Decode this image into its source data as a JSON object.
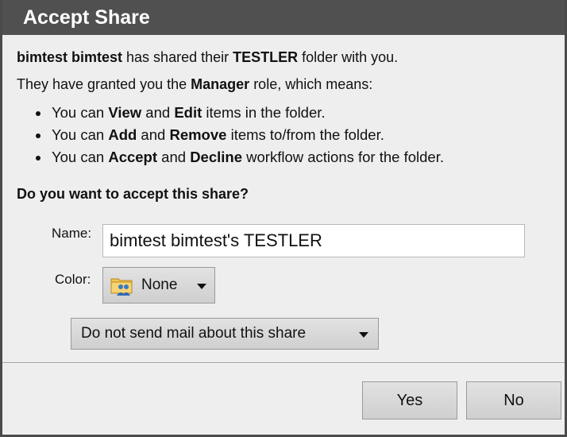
{
  "dialog": {
    "title": "Accept Share",
    "share_user": "bimtest bimtest",
    "share_text_1": " has shared their ",
    "folder": "TESTLER",
    "share_text_2": " folder with you.",
    "role_text_1": "They have granted you the ",
    "role": "Manager",
    "role_text_2": " role, which means:",
    "bullets": [
      {
        "p1": "You can ",
        "b1": "View",
        "p2": " and ",
        "b2": "Edit",
        "p3": " items in the folder."
      },
      {
        "p1": "You can ",
        "b1": "Add",
        "p2": " and ",
        "b2": "Remove",
        "p3": " items to/from the folder."
      },
      {
        "p1": "You can ",
        "b1": "Accept",
        "p2": " and ",
        "b2": "Decline",
        "p3": " workflow actions for the folder."
      }
    ],
    "question": "Do you want to accept this share?",
    "name_label": "Name:",
    "name_value": "bimtest bimtest's TESTLER",
    "color_label": "Color:",
    "color_value": "None",
    "mail_option": "Do not send mail about this share",
    "yes_label": "Yes",
    "no_label": "No"
  },
  "colors": {
    "titlebar": "#505050",
    "body": "#eeeeee"
  },
  "icons": {
    "color_icon": "shared-folder-icon",
    "dropdown": "chevron-down-icon"
  }
}
